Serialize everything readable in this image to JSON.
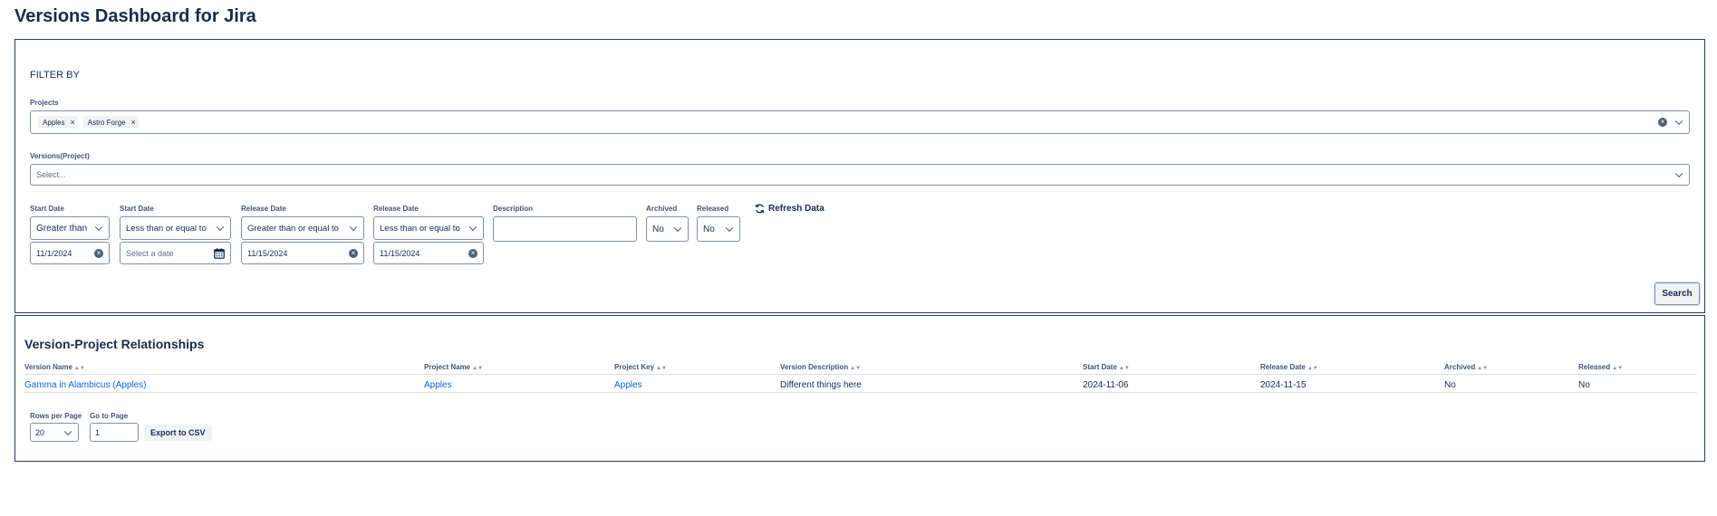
{
  "app": {
    "title": "Versions Dashboard for Jira"
  },
  "filters": {
    "heading": "FILTER BY",
    "projects": {
      "label": "Projects",
      "tags": [
        "Apples",
        "Astro Forge"
      ]
    },
    "versions": {
      "label": "Versions(Project)",
      "placeholder": "Select..."
    },
    "start_date_gt": {
      "label": "Start Date",
      "operator": "Greater than",
      "value": "11/1/2024"
    },
    "start_date_le": {
      "label": "Start Date",
      "operator": "Less than or equal to",
      "placeholder": "Select a date"
    },
    "release_date_ge": {
      "label": "Release Date",
      "operator": "Greater than or equal to",
      "value": "11/15/2024"
    },
    "release_date_le": {
      "label": "Release Date",
      "operator": "Less than or equal to",
      "value": "11/15/2024"
    },
    "description": {
      "label": "Description",
      "value": ""
    },
    "archived": {
      "label": "Archived",
      "value": "No"
    },
    "released": {
      "label": "Released",
      "value": "No"
    },
    "refresh_label": "Refresh Data",
    "search_label": "Search"
  },
  "results": {
    "title": "Version-Project Relationships",
    "columns": [
      "Version Name",
      "Project Name",
      "Project Key",
      "Version Description",
      "Start Date",
      "Release Date",
      "Archived",
      "Released"
    ],
    "rows": [
      [
        "Gamma in Alambicus (Apples)",
        "Apples",
        "Apples",
        "Different things here",
        "2024-11-06",
        "2024-11-15",
        "No",
        "No"
      ]
    ]
  },
  "pagination": {
    "rows_per_page_label": "Rows per Page",
    "rows_per_page_value": "20",
    "go_to_page_label": "Go to Page",
    "go_to_page_value": "1",
    "export_label": "Export to CSV"
  },
  "colors": {
    "link": "#0c66e4",
    "panel_border": "#2b3a67",
    "text": "#172b4d"
  }
}
